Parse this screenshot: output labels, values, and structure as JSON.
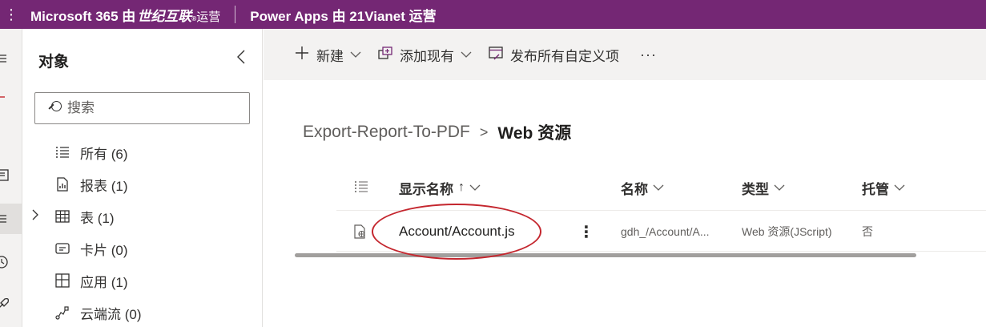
{
  "topbar": {
    "brand_prefix": "Microsoft 365 由",
    "brand_partner": "世纪互联",
    "brand_reg": "®",
    "brand_suffix": "运营",
    "app_title": "Power Apps 由 21Vianet 运营"
  },
  "objects_panel": {
    "title": "对象",
    "search_placeholder": "搜索",
    "items": [
      {
        "label": "所有 (6)",
        "icon": "list-icon"
      },
      {
        "label": "报表 (1)",
        "icon": "report-icon"
      },
      {
        "label": "表 (1)",
        "icon": "table-icon",
        "expandable": true
      },
      {
        "label": "卡片 (0)",
        "icon": "card-icon"
      },
      {
        "label": "应用 (1)",
        "icon": "app-icon"
      },
      {
        "label": "云端流 (0)",
        "icon": "flow-icon"
      }
    ]
  },
  "commands": {
    "new": "新建",
    "add_existing": "添加现有",
    "publish_all": "发布所有自定义项",
    "more": "···"
  },
  "breadcrumb": {
    "parent": "Export-Report-To-PDF",
    "separator": ">",
    "current": "Web 资源"
  },
  "grid": {
    "columns": {
      "display_name": "显示名称",
      "name": "名称",
      "type": "类型",
      "managed": "托管"
    },
    "sort_indicator": "↑",
    "rows": [
      {
        "display_name": "Account/Account.js",
        "name": "gdh_/Account/A...",
        "type": "Web 资源(JScript)",
        "managed": "否"
      }
    ]
  },
  "colors": {
    "topbar": "#742774",
    "annotation": "#c4262e"
  }
}
